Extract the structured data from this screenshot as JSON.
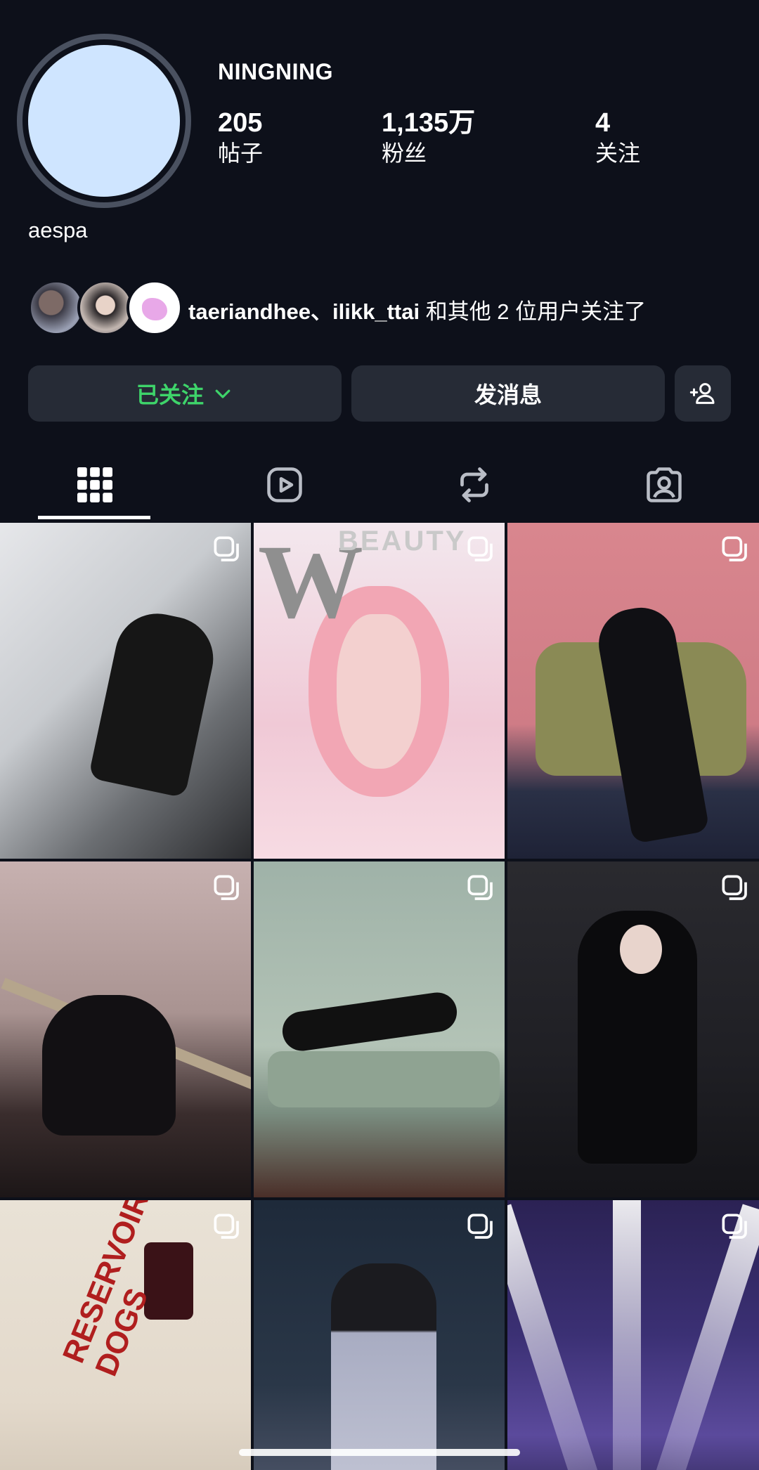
{
  "profile": {
    "username": "NINGNING",
    "display_name": "aespa",
    "stats": [
      {
        "value": "205",
        "label": "帖子"
      },
      {
        "value": "1,135万",
        "label": "粉丝"
      },
      {
        "value": "4",
        "label": "关注"
      }
    ]
  },
  "mutual": {
    "names": "taeriandhee、ilikk_ttai",
    "suffix": " 和其他 2 位用户关注了"
  },
  "actions": {
    "following_label": "已关注",
    "message_label": "发消息"
  },
  "tabs": [
    {
      "icon": "grid-icon",
      "active": true
    },
    {
      "icon": "reels-icon",
      "active": false
    },
    {
      "icon": "repost-icon",
      "active": false
    },
    {
      "icon": "tagged-icon",
      "active": false
    }
  ],
  "posts": [
    {
      "overlay_text": ""
    },
    {
      "overlay_text": "W",
      "overlay_text_2": "BEAUTY"
    },
    {
      "overlay_text": ""
    },
    {
      "overlay_text": ""
    },
    {
      "overlay_text": ""
    },
    {
      "overlay_text": ""
    },
    {
      "overlay_text": "RESERVOIR DOGS"
    },
    {
      "overlay_text": ""
    },
    {
      "overlay_text": ""
    }
  ],
  "colors": {
    "background": "#0d101a",
    "button_bg": "#262b36",
    "following_green": "#3ed46a",
    "avatar_fill": "#cfe5ff"
  }
}
